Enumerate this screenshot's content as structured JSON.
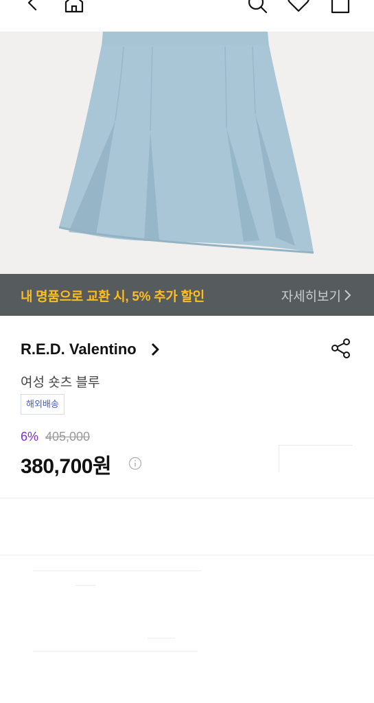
{
  "topbar": {
    "icons": [
      "back-icon",
      "home-icon",
      "search-icon",
      "heart-icon",
      "bag-icon"
    ]
  },
  "promo": {
    "text": "내 명품으로 교환 시, 5% 추가 할인",
    "link": "자세히보기",
    "text_color": "#ffbe1f",
    "background": "#565b5e"
  },
  "product": {
    "brand": "R.E.D. Valentino",
    "name": "여성 숏츠 블루",
    "tag": "해외배송",
    "discount": "6%",
    "original_price": "405,000",
    "price": "380,700원"
  },
  "colors": {
    "discount": "#7b2fd0",
    "tag_text": "#3d5fb8",
    "skirt": "#a9c6d6"
  }
}
